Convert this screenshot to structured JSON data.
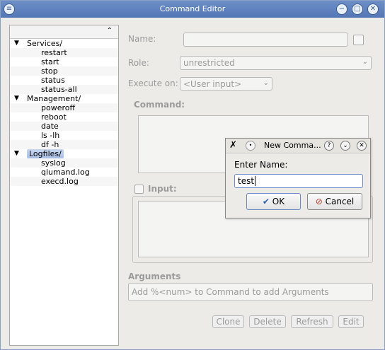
{
  "window": {
    "title": "Command Editor",
    "menu_icon": "window-menu-icon",
    "buttons": [
      "minimize-icon",
      "maximize-icon",
      "close-icon"
    ]
  },
  "tree": {
    "items": [
      {
        "label": "Services/",
        "level": 0,
        "expander": "v"
      },
      {
        "label": "restart",
        "level": 1
      },
      {
        "label": "start",
        "level": 1
      },
      {
        "label": "stop",
        "level": 1
      },
      {
        "label": "status",
        "level": 1
      },
      {
        "label": "status-all",
        "level": 1
      },
      {
        "label": "Management/",
        "level": 0,
        "expander": "v"
      },
      {
        "label": "poweroff",
        "level": 1
      },
      {
        "label": "reboot",
        "level": 1
      },
      {
        "label": "date",
        "level": 1
      },
      {
        "label": "ls -lh",
        "level": 1
      },
      {
        "label": "df -h",
        "level": 1
      },
      {
        "label": "Logfiles/",
        "level": 0,
        "expander": "v",
        "selected": true
      },
      {
        "label": "syslog",
        "level": 1
      },
      {
        "label": "qlumand.log",
        "level": 1
      },
      {
        "label": "execd.log",
        "level": 1
      }
    ]
  },
  "form": {
    "name_label": "Name:",
    "name_value": "",
    "role_label": "Role:",
    "role_value": "unrestricted",
    "execute_on_label": "Execute on:",
    "execute_on_value": "<User input>",
    "command_label": "Command:",
    "input_label": "Input:",
    "arguments_label": "Arguments",
    "arguments_placeholder": "Add %<num> to Command to add Arguments",
    "buttons": {
      "clone": "Clone",
      "delete": "Delete",
      "refresh": "Refresh",
      "edit": "Edit"
    }
  },
  "dialog": {
    "title": "New Comma...",
    "help_button": "?",
    "enter_name_label": "Enter Name:",
    "input_value": "test",
    "ok_label": "OK",
    "cancel_label": "Cancel",
    "colors": {
      "accent": "#6c89c5",
      "cancel_icon": "#c0392b",
      "ok_icon": "#2f5fb3"
    }
  },
  "colors": {
    "titlebar": "#5e82bf",
    "selection": "#b8ccec"
  }
}
